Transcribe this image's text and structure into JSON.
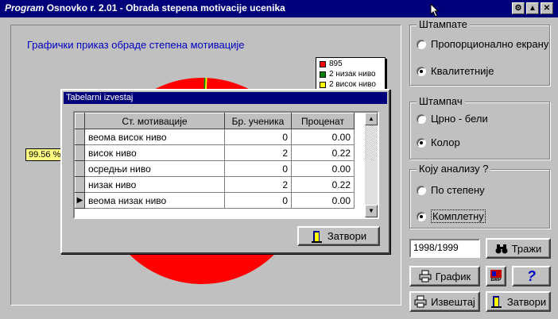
{
  "window": {
    "title_italic": "Program",
    "title_rest": " Osnovko  r. 2.01  - Obrada stepena motivacije ucenika"
  },
  "chart_panel": {
    "title": "Графички приказ обраде степена мотивације",
    "pct_label": "99.56 %",
    "legend": [
      {
        "label": "895",
        "color": "#ff0000"
      },
      {
        "label": "2 низак ниво",
        "color": "#008000"
      },
      {
        "label": "2 висок ниво",
        "color": "#ffff00"
      }
    ]
  },
  "chart_data": {
    "type": "pie",
    "values": [
      895,
      2,
      2
    ],
    "labels": [
      "895",
      "2 низак ниво",
      "2 висок ниво"
    ],
    "colors": [
      "#ff0000",
      "#008000",
      "#ffff00"
    ],
    "annotation": "99.56 %"
  },
  "dialog": {
    "title": "Tabelarni izvestaj",
    "columns": [
      "Ст. мотивације",
      "Бр. ученика",
      "Проценат"
    ],
    "rows": [
      {
        "name": "веома висок ниво",
        "count": "0",
        "pct": "0.00"
      },
      {
        "name": "висок ниво",
        "count": "2",
        "pct": "0.22"
      },
      {
        "name": "осредњи ниво",
        "count": "0",
        "pct": "0.00"
      },
      {
        "name": "низак ниво",
        "count": "2",
        "pct": "0.22"
      },
      {
        "name": "веома низак ниво",
        "count": "0",
        "pct": "0.00"
      }
    ],
    "close_label": "Затвори"
  },
  "print_group": {
    "label": "Штампате",
    "options": [
      "Пропорционално екрану",
      "Квалитетније"
    ],
    "selected": 1
  },
  "printer_group": {
    "label": "Штампач",
    "options": [
      "Црно - бели",
      "Колор"
    ],
    "selected": 1
  },
  "analysis_group": {
    "label": "Коју анализу ?",
    "options": [
      "По степену",
      "Комплетну"
    ],
    "selected": 1
  },
  "year_input": {
    "value": "1998/1999"
  },
  "buttons": {
    "search": "Тражи",
    "chart": "График",
    "bmp": "BMP",
    "help": "?",
    "report": "Извештај",
    "close": "Затвори"
  }
}
